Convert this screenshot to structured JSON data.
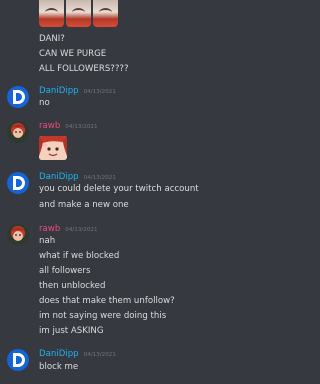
{
  "messages": [
    {
      "lines": [
        "DANI?",
        "CAN WE PURGE",
        "ALL FOLLOWERS????"
      ]
    },
    {
      "author": "DaniDipp",
      "time": "04/13/2021",
      "lines": [
        "no"
      ]
    },
    {
      "author": "rawb",
      "time": "04/13/2021",
      "lines": []
    },
    {
      "author": "DaniDipp",
      "time": "04/13/2021",
      "lines": [
        "you could delete your twitch account",
        "and make a new one"
      ]
    },
    {
      "author": "rawb",
      "time": "04/13/2021",
      "lines": [
        "nah",
        "what if we blocked",
        "all followers",
        "then unblocked",
        "does that make them unfollow?",
        "im not saying were doing this",
        "im just ASKING"
      ]
    },
    {
      "author": "DaniDipp",
      "time": "04/13/2021",
      "lines": [
        "block me"
      ]
    }
  ],
  "colors": {
    "background": "#36393f",
    "text": "#dcddde",
    "name_danidipp": "#20b4f5",
    "name_rawb": "#f04a7c",
    "timestamp": "#72767d"
  },
  "icons": {
    "danidipp_avatar": "danidipp-logo-icon",
    "rawb_avatar": "rawb-avatar-icon",
    "emote": "emote-icon"
  }
}
